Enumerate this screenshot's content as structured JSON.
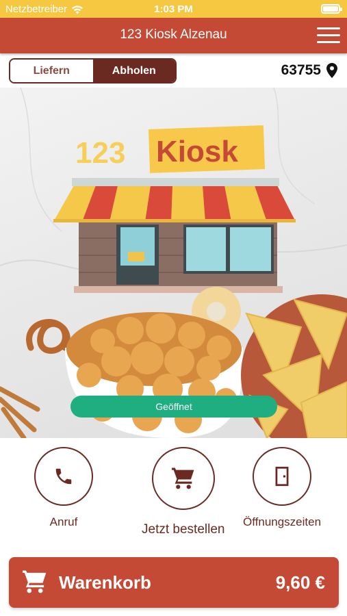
{
  "status_bar": {
    "carrier": "Netzbetreiber",
    "time": "1:03 PM",
    "icons": [
      "wifi-icon",
      "battery-icon"
    ]
  },
  "header": {
    "title": "123 Kiosk Alzenau",
    "menu_icon": "hamburger-menu-icon"
  },
  "mode_toggle": {
    "options": [
      {
        "label": "Liefern",
        "selected": false
      },
      {
        "label": "Abholen",
        "selected": true
      }
    ]
  },
  "location": {
    "zip": "63755",
    "icon": "location-pin-icon"
  },
  "hero": {
    "logo": {
      "number": "123",
      "word": "Kiosk"
    },
    "open_status": "Geöffnet"
  },
  "actions": [
    {
      "label": "Anruf",
      "icon": "phone-icon"
    },
    {
      "label": "Jetzt bestellen",
      "icon": "cart-icon"
    },
    {
      "label": "Öffnungszeiten",
      "icon": "door-icon"
    }
  ],
  "cart": {
    "label": "Warenkorb",
    "total": "9,60 €",
    "icon": "cart-icon"
  },
  "colors": {
    "status_bar": "#f6c842",
    "primary": "#c54a36",
    "dark_brown": "#6b2a21",
    "open_green": "#1fae80"
  }
}
